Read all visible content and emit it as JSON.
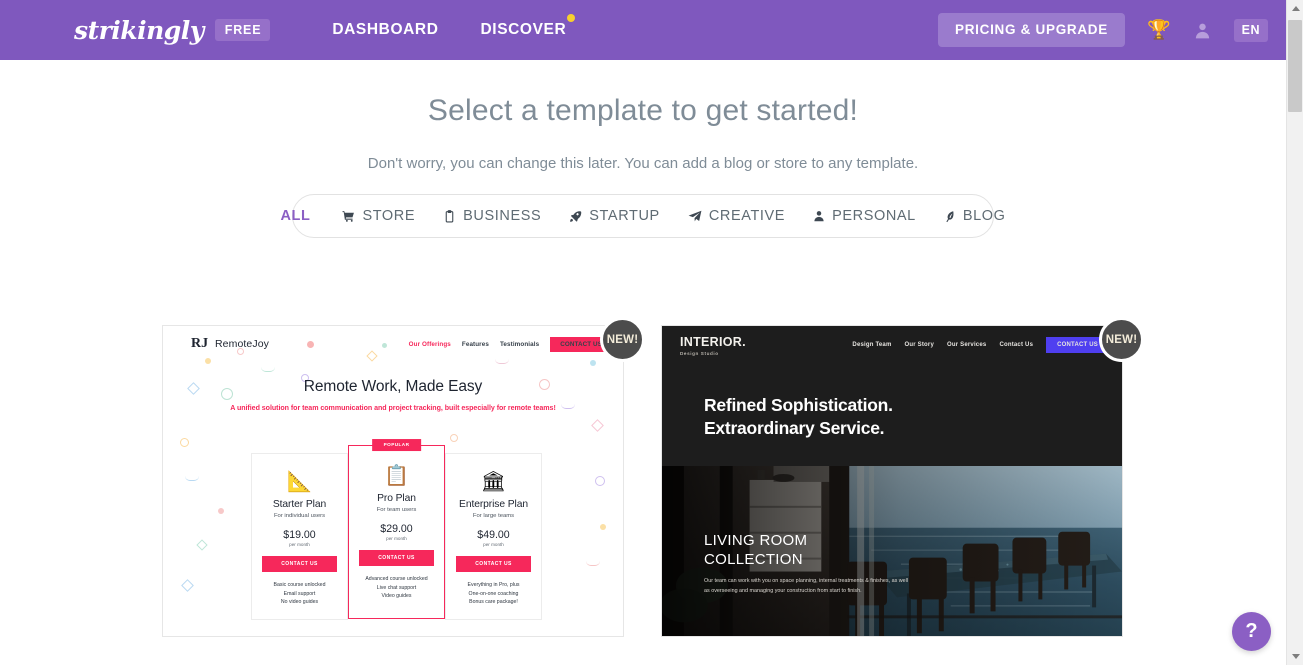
{
  "header": {
    "logo": "strikingly",
    "plan_badge": "FREE",
    "nav": [
      {
        "label": "DASHBOARD",
        "has_dot": false
      },
      {
        "label": "DISCOVER",
        "has_dot": true
      }
    ],
    "pricing_button": "PRICING & UPGRADE",
    "trophy_icon": "trophy-icon",
    "avatar_icon": "user-avatar-icon",
    "language": "EN",
    "background_color": "#7f58be",
    "dot_color": "#f7cf2e"
  },
  "main": {
    "title": "Select a template to get started!",
    "subtitle": "Don't worry, you can change this later. You can add a blog or store to any template."
  },
  "filters": [
    {
      "label": "ALL",
      "icon": "none",
      "active": true
    },
    {
      "label": "STORE",
      "icon": "cart-icon",
      "active": false
    },
    {
      "label": "BUSINESS",
      "icon": "clipboard-icon",
      "active": false
    },
    {
      "label": "STARTUP",
      "icon": "rocket-icon",
      "active": false
    },
    {
      "label": "CREATIVE",
      "icon": "paper-plane-icon",
      "active": false
    },
    {
      "label": "PERSONAL",
      "icon": "person-icon",
      "active": false
    },
    {
      "label": "BLOG",
      "icon": "quill-icon",
      "active": false
    }
  ],
  "templates": [
    {
      "badge": "NEW!",
      "brand": "RemoteJoy",
      "logo_mark": "RJ",
      "nav": [
        "Our Offerings",
        "Features",
        "Testimonials"
      ],
      "nav_cta": "CONTACT US",
      "headline": "Remote Work, Made Easy",
      "subheadline": "A unified solution for team communication and project tracking, built especially for remote teams!",
      "accent_color": "#f6285b",
      "popular_tag": "POPULAR",
      "plans": [
        {
          "icon": "pen-ruler-icon",
          "name": "Starter Plan",
          "audience": "For individual users",
          "price": "$19.00",
          "period": "per month",
          "cta": "CONTACT US",
          "features": [
            "Basic course unlocked",
            "Email support",
            "No video guides"
          ],
          "featured": false
        },
        {
          "icon": "clipboard-ruler-icon",
          "name": "Pro Plan",
          "audience": "For team users",
          "price": "$29.00",
          "period": "per month",
          "cta": "CONTACT US",
          "features": [
            "Advanced course unlocked",
            "Live chat support",
            "Video guides"
          ],
          "featured": true
        },
        {
          "icon": "building-icon",
          "name": "Enterprise Plan",
          "audience": "For large teams",
          "price": "$49.00",
          "period": "per month",
          "cta": "CONTACT US",
          "features": [
            "Everything in Pro, plus",
            "One-on-one coaching",
            "Bonus care package!"
          ],
          "featured": false
        }
      ]
    },
    {
      "badge": "NEW!",
      "brand": "INTERIOR.",
      "brand_sub": "Design Studio",
      "nav": [
        "Design Team",
        "Our Story",
        "Our Services",
        "Contact Us"
      ],
      "nav_cta": "CONTACT US",
      "headline_line1": "Refined Sophistication.",
      "headline_line2": "Extraordinary Service.",
      "caption_line1": "LIVING ROOM",
      "caption_line2": "COLLECTION",
      "caption_body": "Our team can work with you on space planning, internal treatments & finishes, as well as overseeing and managing your construction from start to finish.",
      "accent_color": "#4f3ff0",
      "background_color": "#1d1d1d"
    }
  ],
  "help": {
    "label": "?",
    "color": "#8b5fc4"
  },
  "scrollbar": {
    "up_icon": "scroll-up-arrow",
    "down_icon": "scroll-down-arrow"
  }
}
